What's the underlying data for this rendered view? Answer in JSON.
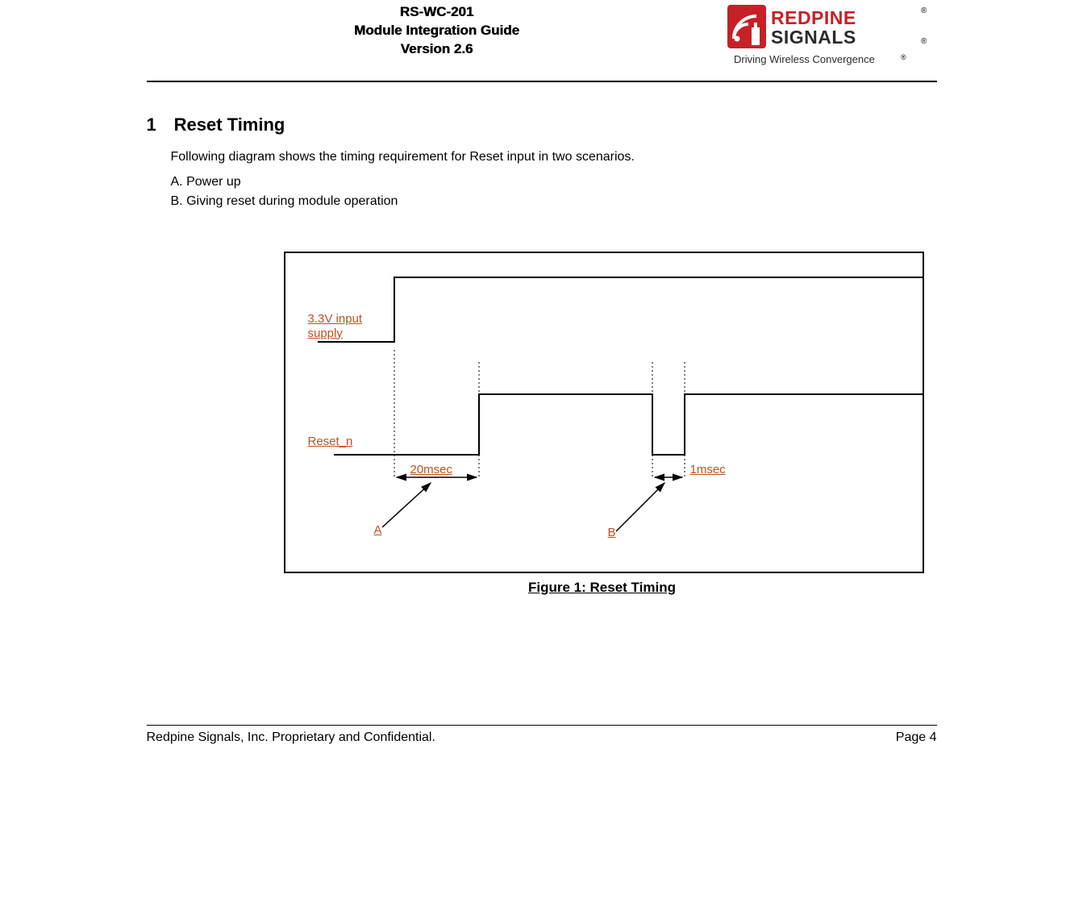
{
  "header": {
    "product": "RS-WC-201",
    "doc_title": "Module Integration Guide",
    "version": "Version 2.6",
    "brand_top": "REDPINE",
    "brand_bottom": "SIGNALS",
    "brand_tagline": "Driving Wireless Convergence"
  },
  "section": {
    "number": "1",
    "title": "Reset Timing",
    "intro": "Following diagram shows the timing requirement for Reset input in two scenarios.",
    "item_a": "A. Power up",
    "item_b": "B. Giving reset during module operation"
  },
  "diagram": {
    "supply_label": "3.3V input supply",
    "reset_label": "Reset_n",
    "time_a": "20msec",
    "time_b": "1msec",
    "marker_a": "A",
    "marker_b": "B"
  },
  "figure": {
    "caption": "Figure 1: Reset Timing"
  },
  "footer": {
    "left": "Redpine Signals, Inc. Proprietary and Confidential.",
    "right": "Page 4"
  }
}
